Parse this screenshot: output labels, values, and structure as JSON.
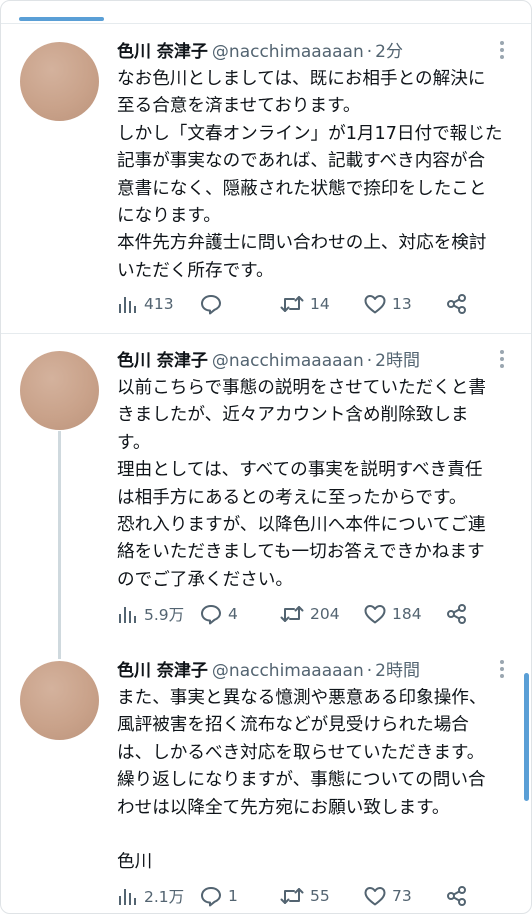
{
  "tweets": [
    {
      "author_name": "色川 奈津子",
      "handle": "@nacchimaaaaan",
      "time": "2分",
      "lines": [
        "なお色川としましては、既にお相手との解決に",
        "至る合意を済ませております。",
        "しかし「文春オンライン」が1月17日付で報じた",
        "記事が事実なのであれば、記載すべき内容が合",
        "意書になく、隠蔽された状態で捺印をしたこと",
        "になります。",
        "本件先方弁護士に問い合わせの上、対応を検討",
        "いただく所存です。"
      ],
      "views": "413",
      "replies": "",
      "retweets": "14",
      "likes": "13"
    },
    {
      "author_name": "色川 奈津子",
      "handle": "@nacchimaaaaan",
      "time": "2時間",
      "lines": [
        "以前こちらで事態の説明をさせていただくと書",
        "きましたが、近々アカウント含め削除致しま",
        "す。",
        "理由としては、すべての事実を説明すべき責任",
        "は相手方にあるとの考えに至ったからです。",
        "恐れ入りますが、以降色川へ本件についてご連",
        "絡をいただきましても一切お答えできかねます",
        "のでご了承ください。"
      ],
      "views": "5.9万",
      "replies": "4",
      "retweets": "204",
      "likes": "184"
    },
    {
      "author_name": "色川 奈津子",
      "handle": "@nacchimaaaaan",
      "time": "2時間",
      "lines": [
        "また、事実と異なる憶測や悪意ある印象操作、",
        "風評被害を招く流布などが見受けられた場合",
        "は、しかるべき対応を取らせていただきます。",
        "繰り返しになりますが、事態についての問い合",
        "わせは以降全て先方宛にお願い致します。",
        "",
        "色川"
      ],
      "views": "2.1万",
      "replies": "1",
      "retweets": "55",
      "likes": "73"
    }
  ],
  "colors": {
    "accent": "#1d9bf0",
    "scrollbar": "#5a9fd6",
    "muted": "#536471",
    "text": "#0f1419"
  },
  "icons": [
    "views-icon",
    "reply-icon",
    "retweet-icon",
    "like-icon",
    "share-icon",
    "more-icon"
  ]
}
